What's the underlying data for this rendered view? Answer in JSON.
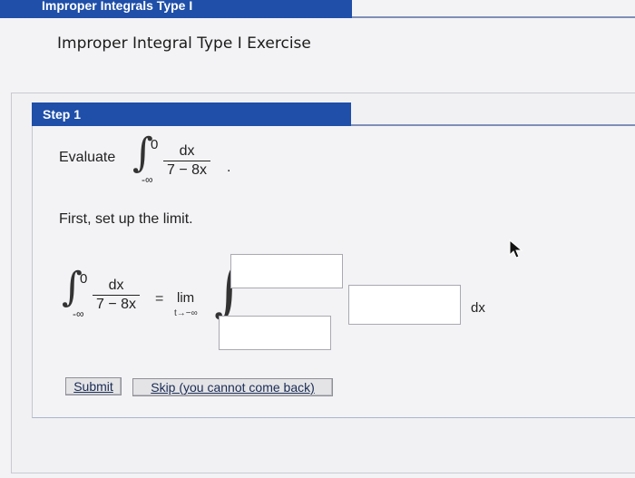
{
  "header": {
    "title": "Improper Integrals Type I"
  },
  "exercise": {
    "title": "Improper Integral Type I Exercise"
  },
  "step": {
    "label": "Step 1",
    "evaluate_label": "Evaluate",
    "integral": {
      "upper_limit": "0",
      "lower_limit": "-∞",
      "numerator": "dx",
      "denominator": "7 − 8x",
      "end_punct": "."
    },
    "setup_text": "First, set up the limit.",
    "limit_equation": {
      "upper_limit": "0",
      "lower_limit": "-∞",
      "numerator": "dx",
      "denominator": "7 − 8x",
      "equals": "=",
      "lim_word": "lim",
      "lim_subscript": "t→−∞",
      "upper_input_value": "",
      "lower_input_value": "",
      "integrand_input_value": "",
      "dx_label": "dx"
    }
  },
  "buttons": {
    "submit_label": "Submit",
    "skip_label": "Skip (you cannot come back)"
  },
  "icons": {
    "cursor": "mouse-pointer-icon"
  },
  "colors": {
    "header_blue": "#1f4fa8"
  }
}
